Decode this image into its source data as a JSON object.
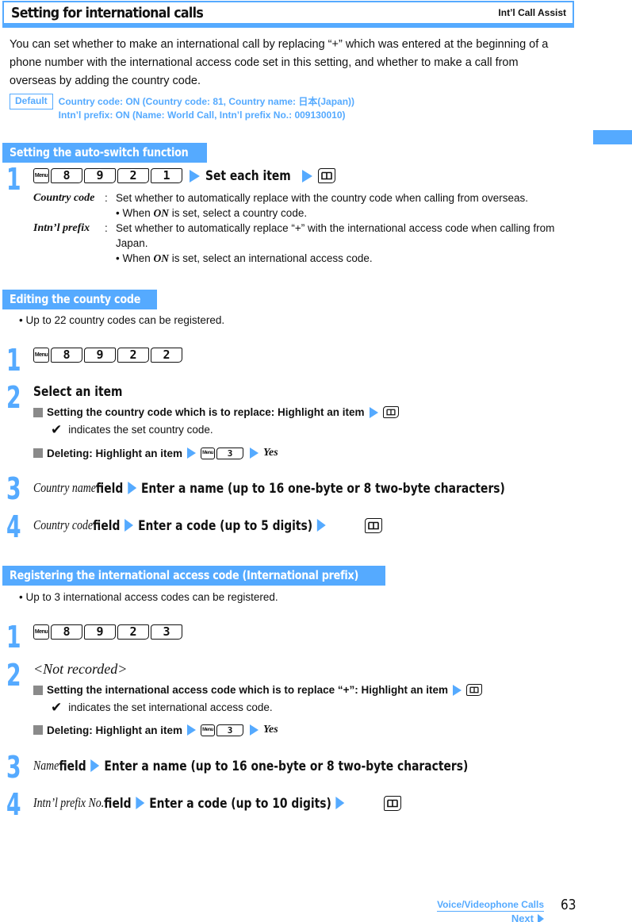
{
  "header": {
    "title": "Setting for international calls",
    "subtitle": "Int’l Call Assist"
  },
  "intro": "You can set whether to make an international call by replacing “+” which was entered at the beginning of a phone number with the international access code set in this setting, and whether to make a call from overseas by adding the country code.",
  "default": {
    "badge": "Default",
    "line1": "Country code: ON (Country code: 81, Country name: 日本(Japan))",
    "line2": "Intn’l prefix: ON (Name: World Call, Intn’l prefix No.: 009130010)"
  },
  "keys": {
    "menu": "Menu",
    "book": "📖"
  },
  "sections": [
    {
      "heading": "Setting the auto-switch function",
      "step1": {
        "num": "1",
        "keys": [
          "8",
          "9",
          "2",
          "1"
        ],
        "text1": "Set each item"
      },
      "items": [
        {
          "term": "Country code",
          "colon": ":",
          "desc": "Set whether to automatically replace with the country code when calling from overseas.",
          "bullet_pre": "• When ",
          "bullet_em": "ON",
          "bullet_post": " is set, select a country code."
        },
        {
          "term": "Intn’l prefix",
          "colon": ":",
          "desc": "Set whether to automatically replace “+” with the international access code when calling from Japan.",
          "bullet_pre": "• When ",
          "bullet_em": "ON",
          "bullet_post": " is set, select an international access code."
        }
      ]
    },
    {
      "heading": "Editing the county code",
      "note": "• Up to 22 country codes can be registered.",
      "step1": {
        "num": "1",
        "keys": [
          "8",
          "9",
          "2",
          "2"
        ]
      },
      "step2": {
        "num": "2",
        "title": "Select an item",
        "sub1": "Setting the country code which is to replace: Highlight an item",
        "check_text": "indicates the set country code.",
        "sub2": "Deleting: Highlight an item",
        "sub2_key": "3",
        "sub2_end": "Yes"
      },
      "step3": {
        "num": "3",
        "field": "Country name",
        "field_word": " field",
        "action": "Enter a name (up to 16 one-byte or 8 two-byte characters)"
      },
      "step4": {
        "num": "4",
        "field": "Country code",
        "field_word": " field",
        "action": "Enter a code (up to 5 digits)"
      }
    },
    {
      "heading": "Registering the international access code (International prefix)",
      "note": "• Up to 3 international access codes can be registered.",
      "step1": {
        "num": "1",
        "keys": [
          "8",
          "9",
          "2",
          "3"
        ]
      },
      "step2": {
        "num": "2",
        "title": "<Not recorded>",
        "sub1": "Setting the international access code which is to replace “+”: Highlight an item",
        "check_text": "indicates the set international access code.",
        "sub2": "Deleting: Highlight an item",
        "sub2_key": "3",
        "sub2_end": "Yes"
      },
      "step3": {
        "num": "3",
        "field": "Name",
        "field_word": " field",
        "action": "Enter a name (up to 16 one-byte or 8 two-byte characters)"
      },
      "step4": {
        "num": "4",
        "field": "Intn’l prefix No.",
        "field_word": " field",
        "action": "Enter a code (up to 10 digits)"
      }
    }
  ],
  "footer": {
    "section_link": "Voice/Videophone Calls",
    "next": "Next",
    "page_number": "63"
  },
  "colors": {
    "accent": "#55aaff",
    "text": "#111111",
    "square_bullet": "#8a8a8a"
  }
}
